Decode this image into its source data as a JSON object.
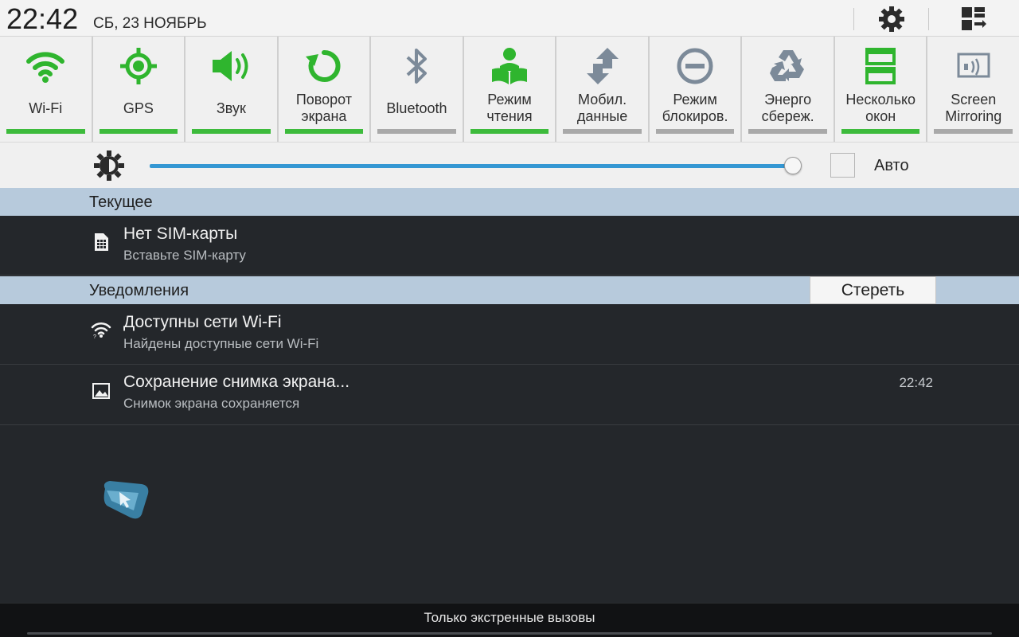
{
  "status": {
    "time": "22:42",
    "date": "СБ, 23 НОЯБРЬ"
  },
  "header": {
    "settings_icon": "gear-icon",
    "edit_icon": "grid-edit-icon"
  },
  "toggles": [
    {
      "label": "Wi-Fi",
      "icon": "wifi-icon",
      "on": true
    },
    {
      "label": "GPS",
      "icon": "gps-icon",
      "on": true
    },
    {
      "label": "Звук",
      "icon": "sound-icon",
      "on": true
    },
    {
      "label": "Поворот\nэкрана",
      "icon": "rotate-icon",
      "on": true
    },
    {
      "label": "Bluetooth",
      "icon": "bluetooth-icon",
      "on": false
    },
    {
      "label": "Режим\nчтения",
      "icon": "reading-mode-icon",
      "on": true
    },
    {
      "label": "Мобил.\nданные",
      "icon": "mobile-data-icon",
      "on": false
    },
    {
      "label": "Режим\nблокиров.",
      "icon": "block-mode-icon",
      "on": false
    },
    {
      "label": "Энерго\nсбереж.",
      "icon": "power-saving-icon",
      "on": false
    },
    {
      "label": "Несколько\nокон",
      "icon": "multi-window-icon",
      "on": true
    },
    {
      "label": "Screen\nMirroring",
      "icon": "screen-mirroring-icon",
      "on": false
    }
  ],
  "brightness": {
    "level": 1.0,
    "auto_label": "Авто",
    "auto_checked": false
  },
  "ongoing": {
    "header": "Текущее",
    "items": [
      {
        "title": "Нет SIM-карты",
        "subtitle": "Вставьте SIM-карту",
        "icon": "sim-card-icon"
      }
    ]
  },
  "notifications": {
    "header": "Уведомления",
    "clear_label": "Стереть",
    "items": [
      {
        "title": "Доступны сети Wi-Fi",
        "subtitle": "Найдены доступные сети Wi-Fi",
        "icon": "wifi-notification-icon",
        "time": ""
      },
      {
        "title": "Сохранение снимка экрана...",
        "subtitle": "Снимок экрана сохраняется",
        "icon": "image-icon",
        "time": "22:42"
      }
    ]
  },
  "footer": {
    "text": "Только экстренные вызовы"
  },
  "colors": {
    "accent_green": "#3dbb3c",
    "accent_blue": "#3497d3",
    "section_bg": "#b7cadc",
    "panel_bg": "#24272b"
  }
}
